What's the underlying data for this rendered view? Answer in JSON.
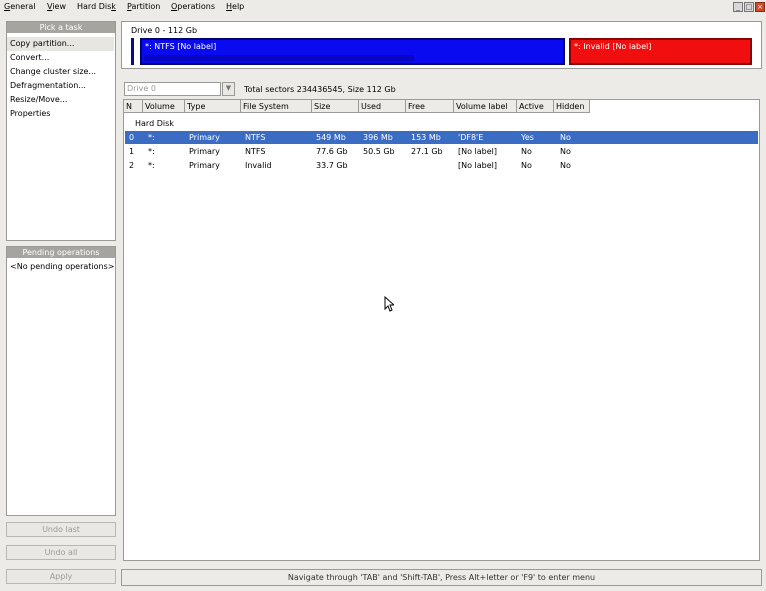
{
  "menu": [
    {
      "pre": "",
      "u": "G",
      "post": "eneral"
    },
    {
      "pre": "",
      "u": "V",
      "post": "iew"
    },
    {
      "pre": "Hard Dis",
      "u": "k",
      "post": ""
    },
    {
      "pre": "",
      "u": "P",
      "post": "artition"
    },
    {
      "pre": "",
      "u": "O",
      "post": "perations"
    },
    {
      "pre": "",
      "u": "H",
      "post": "elp"
    }
  ],
  "tasks": {
    "title": "Pick a task",
    "items": [
      "Copy partition...",
      "Convert...",
      "Change cluster size...",
      "Defragmentation...",
      "Resize/Move...",
      "Properties"
    ]
  },
  "pending": {
    "title": "Pending operations",
    "empty": "<No pending operations>"
  },
  "buttons": {
    "undo_last": "Undo last",
    "undo_all": "Undo all",
    "apply": "Apply"
  },
  "drive": {
    "label": "Drive 0 - 112 Gb",
    "partitions": [
      {
        "text": "*: NTFS [No label]",
        "color": "#0a0af0"
      },
      {
        "text": "*: Invalid [No label]",
        "color": "#f00e0e"
      }
    ]
  },
  "drive_select": {
    "value": "Drive 0",
    "arrow": "▼"
  },
  "total_info": "Total sectors 234436545, Size 112 Gb",
  "table": {
    "headers": [
      "N",
      "Volume",
      "Type",
      "File System",
      "Size",
      "Used",
      "Free",
      "Volume label",
      "Active",
      "Hidden"
    ],
    "group": "Hard Disk",
    "rows": [
      [
        "0",
        "*:",
        "Primary",
        "NTFS",
        "549 Mb",
        "396 Mb",
        "153 Mb",
        "'DF8'E",
        "Yes",
        "No"
      ],
      [
        "1",
        "*:",
        "Primary",
        "NTFS",
        "77.6 Gb",
        "50.5 Gb",
        "27.1 Gb",
        "[No label]",
        "No",
        "No"
      ],
      [
        "2",
        "*:",
        "Primary",
        "Invalid",
        "33.7 Gb",
        "",
        "",
        "[No label]",
        "No",
        "No"
      ]
    ]
  },
  "status": "Navigate through 'TAB' and 'Shift-TAB', Press Alt+letter or 'F9' to enter menu"
}
